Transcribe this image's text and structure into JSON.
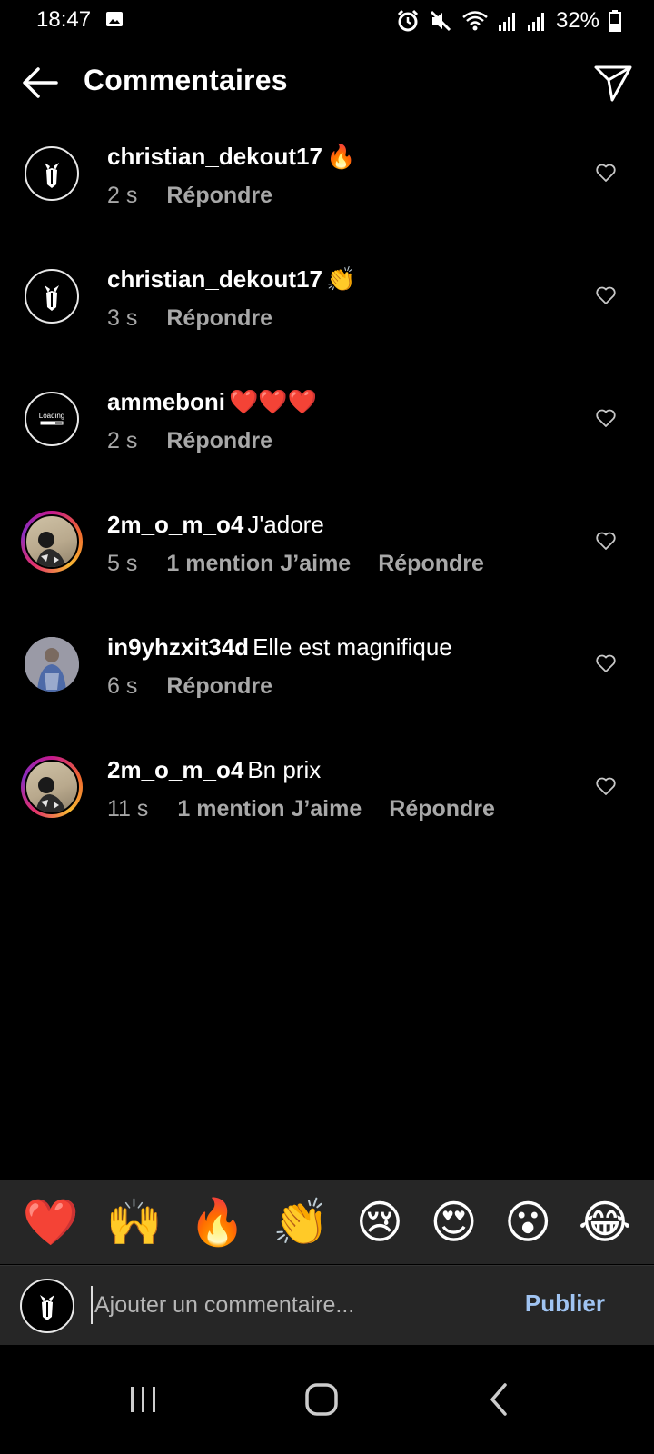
{
  "status_bar": {
    "time": "18:47",
    "battery": "32%"
  },
  "header": {
    "title": "Commentaires"
  },
  "comments": [
    {
      "username": "christian_dekout17",
      "text": "🔥",
      "time": "2 s",
      "likes": "",
      "reply": "Répondre"
    },
    {
      "username": "christian_dekout17",
      "text": "👏",
      "time": "3 s",
      "likes": "",
      "reply": "Répondre"
    },
    {
      "username": "ammeboni",
      "text": "❤️❤️❤️",
      "time": "2 s",
      "likes": "",
      "reply": "Répondre"
    },
    {
      "username": "2m_o_m_o4",
      "text": "J'adore",
      "time": "5 s",
      "likes": "1 mention J’aime",
      "reply": "Répondre"
    },
    {
      "username": "in9yhzxit34d",
      "text": "Elle est magnifique",
      "time": "6 s",
      "likes": "",
      "reply": "Répondre"
    },
    {
      "username": "2m_o_m_o4",
      "text": "Bn prix",
      "time": "11 s",
      "likes": "1 mention J’aime",
      "reply": "Répondre"
    }
  ],
  "emoji_bar": [
    "❤️",
    "🙌",
    "🔥",
    "👏",
    "😢",
    "😍",
    "😮",
    "😂"
  ],
  "composer": {
    "placeholder": "Ajouter un commentaire...",
    "publish_label": "Publier"
  },
  "avatar_label": "Loading",
  "colors": {
    "background": "#000000",
    "secondary_text": "#a8a8a8",
    "publish": "#a0c4f2",
    "panel": "#262626"
  }
}
